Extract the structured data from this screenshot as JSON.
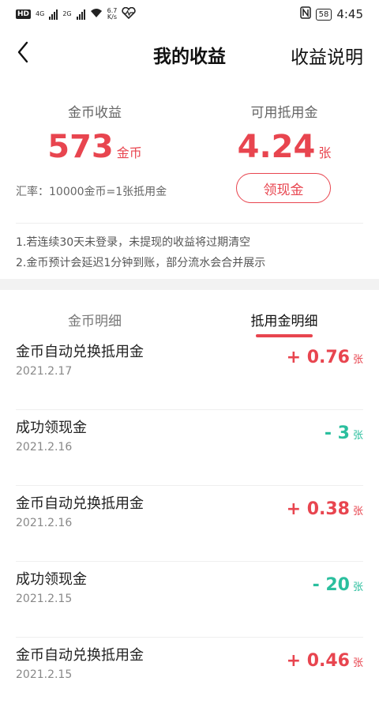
{
  "status_bar": {
    "hd": "HD",
    "net1": "4G",
    "net2": "2G",
    "speed": "6.7",
    "speed_unit": "K/s",
    "battery": "58",
    "time": "4:45"
  },
  "header": {
    "title": "我的收益",
    "help_link": "收益说明"
  },
  "summary": {
    "coin_label": "金币收益",
    "coin_value": "573",
    "coin_unit": "金币",
    "cash_label": "可用抵用金",
    "cash_value": "4.24",
    "cash_unit": "张",
    "rate_text": "汇率：10000金币=1张抵用金",
    "withdraw_button": "领现金"
  },
  "notes": [
    "1.若连续30天未登录，未提现的收益将过期清空",
    "2.金币预计会延迟1分钟到账，部分流水会合并展示"
  ],
  "tabs": [
    {
      "label": "金币明细",
      "active": false
    },
    {
      "label": "抵用金明细",
      "active": true
    }
  ],
  "records": [
    {
      "title": "金币自动兑换抵用金",
      "date": "2021.2.17",
      "amount": "+ 0.76",
      "unit": "张",
      "type": "pos"
    },
    {
      "title": "成功领现金",
      "date": "2021.2.16",
      "amount": "- 3",
      "unit": "张",
      "type": "neg"
    },
    {
      "title": "金币自动兑换抵用金",
      "date": "2021.2.16",
      "amount": "+ 0.38",
      "unit": "张",
      "type": "pos"
    },
    {
      "title": "成功领现金",
      "date": "2021.2.15",
      "amount": "- 20",
      "unit": "张",
      "type": "neg"
    },
    {
      "title": "金币自动兑换抵用金",
      "date": "2021.2.15",
      "amount": "+ 0.46",
      "unit": "张",
      "type": "pos"
    }
  ],
  "colors": {
    "accent": "#e8454f",
    "negative": "#2bbf9e"
  }
}
